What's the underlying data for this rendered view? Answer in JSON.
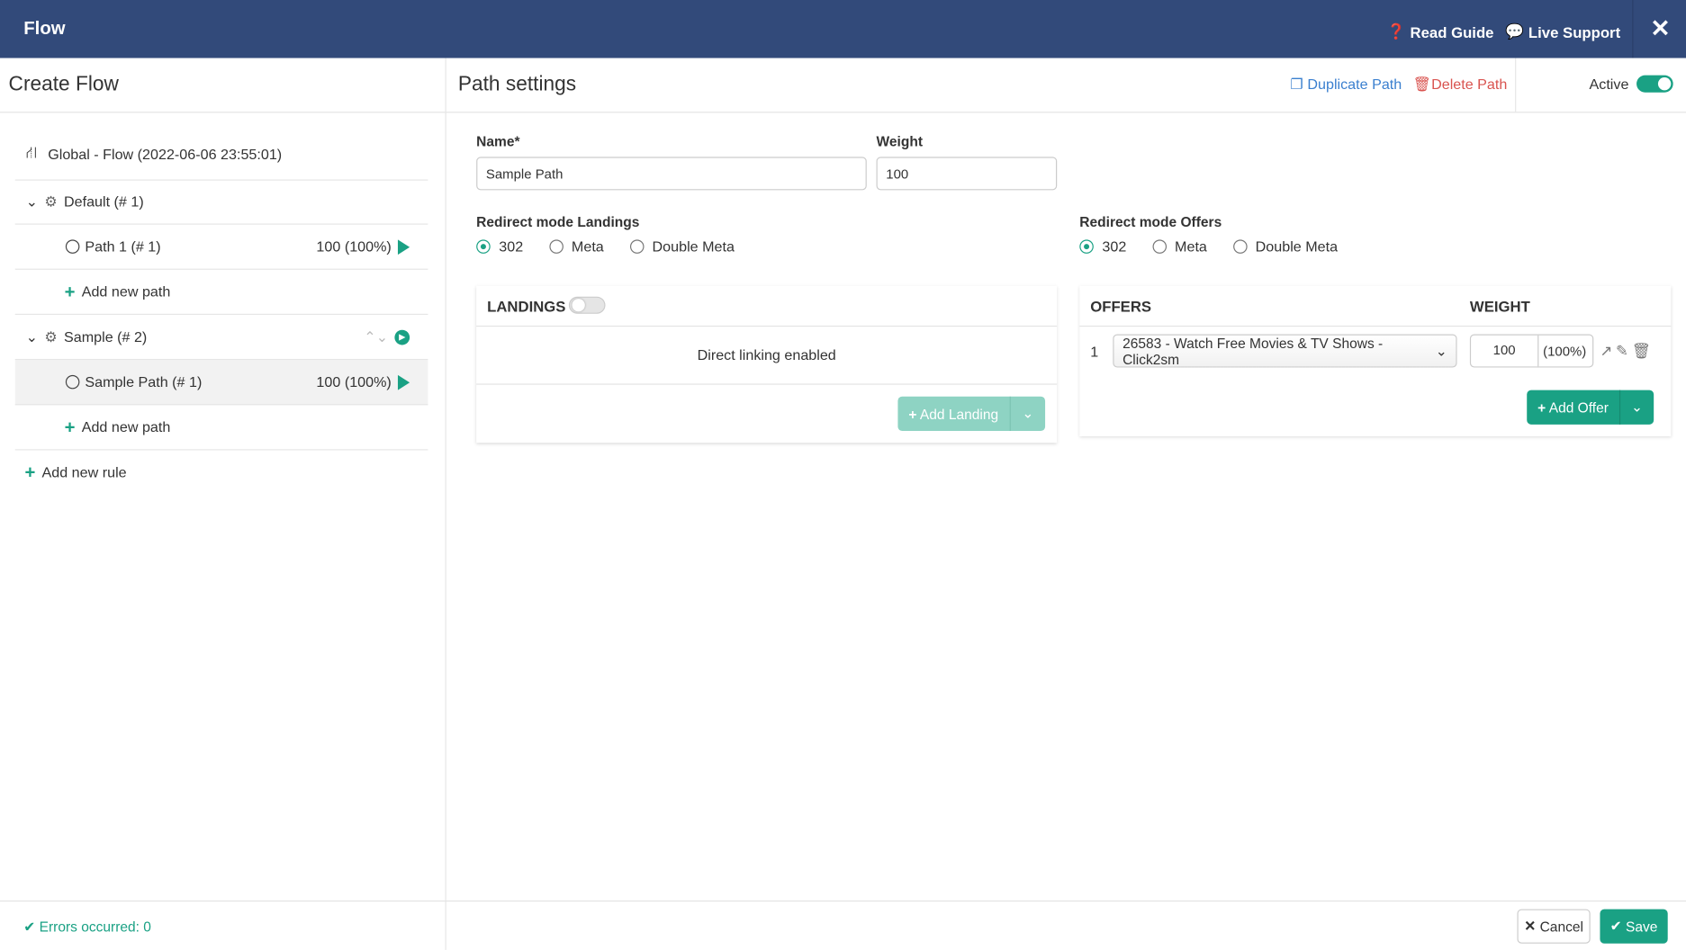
{
  "topbar": {
    "title": "Flow",
    "read_guide": "Read Guide",
    "live_support": "Live Support"
  },
  "left": {
    "title": "Create Flow",
    "global": "Global - Flow (2022-06-06 23:55:01)",
    "rules": [
      {
        "name": "Default (# 1)",
        "paths": [
          {
            "name": "Path 1 (# 1)",
            "weight": "100 (100%)"
          }
        ],
        "add_path": "Add new path"
      },
      {
        "name": "Sample (# 2)",
        "paths": [
          {
            "name": "Sample Path (# 1)",
            "weight": "100 (100%)",
            "selected": true
          }
        ],
        "add_path": "Add new path"
      }
    ],
    "add_rule": "Add new rule",
    "errors": "Errors occurred: 0"
  },
  "main": {
    "title": "Path settings",
    "duplicate": "Duplicate Path",
    "delete": "Delete Path",
    "active_label": "Active",
    "active": true,
    "name_label": "Name*",
    "name_value": "Sample Path",
    "weight_label": "Weight",
    "weight_value": "100",
    "redirect_landings": {
      "label": "Redirect mode Landings",
      "options": [
        "302",
        "Meta",
        "Double Meta"
      ],
      "selected": "302"
    },
    "redirect_offers": {
      "label": "Redirect mode Offers",
      "options": [
        "302",
        "Meta",
        "Double Meta"
      ],
      "selected": "302"
    },
    "landings": {
      "header": "LANDINGS",
      "enabled": false,
      "message": "Direct linking enabled",
      "add_button": "Add Landing"
    },
    "offers": {
      "header": "OFFERS",
      "weight_header": "WEIGHT",
      "rows": [
        {
          "index": "1",
          "offer": "26583 - Watch Free Movies & TV Shows - Click2sm",
          "weight": "100",
          "percent": "(100%)"
        }
      ],
      "add_button": "Add Offer"
    },
    "cancel": "Cancel",
    "save": "Save"
  },
  "colors": {
    "topbar": "#324a7a",
    "accent": "#1aa184",
    "link": "#3a7fcf",
    "danger": "#d9534f"
  }
}
